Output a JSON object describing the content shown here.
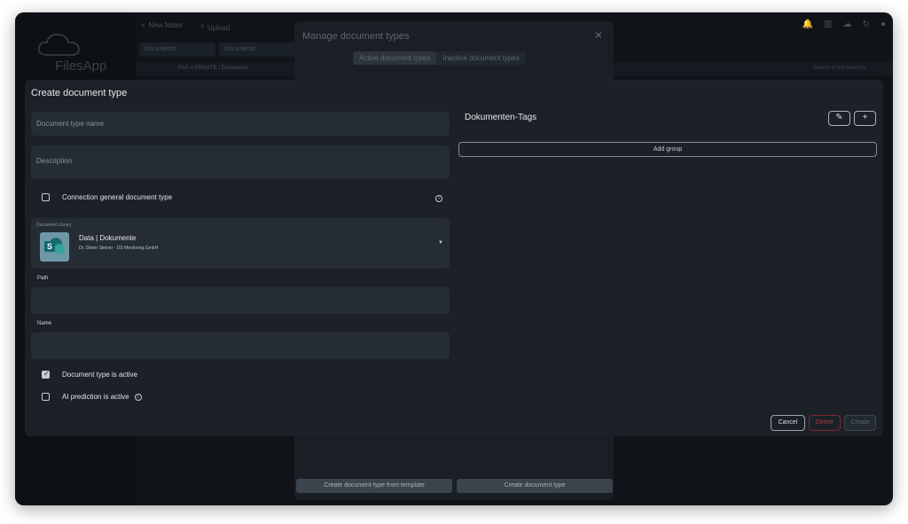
{
  "background": {
    "app_name": "FilesApp",
    "toolbar": {
      "new_folder": "New folder",
      "upload": "Upload"
    },
    "tabs": [
      "Documents",
      "Documents"
    ],
    "path": "FAG 4 PRIVATE / Documents",
    "search_placeholder": "Search in the directory"
  },
  "manage_dialog": {
    "title": "Manage document types",
    "close": "✕",
    "tabs": [
      {
        "label": "Active document types",
        "active": true
      },
      {
        "label": "Inactive document types",
        "active": false
      }
    ],
    "footer": {
      "from_template": "Create document type from template",
      "create": "Create document type"
    }
  },
  "create_dialog": {
    "title": "Create document type",
    "name_placeholder": "Document type name",
    "description_placeholder": "Description",
    "connection_label": "Connection general document type",
    "library": {
      "label": "Document Library",
      "name": "Data | Dokumente",
      "subtitle": "Dr. Dieter Steiner - DS Mentoring GmbH"
    },
    "path_label": "Path",
    "name_label": "Name",
    "active_label": "Document type is active",
    "active_checked": true,
    "ai_label": "AI prediction is active",
    "ai_checked": false,
    "tags_title": "Dokumenten-Tags",
    "add_group": "Add group",
    "buttons": {
      "cancel": "Cancel",
      "delete": "Delete",
      "create": "Create"
    }
  }
}
